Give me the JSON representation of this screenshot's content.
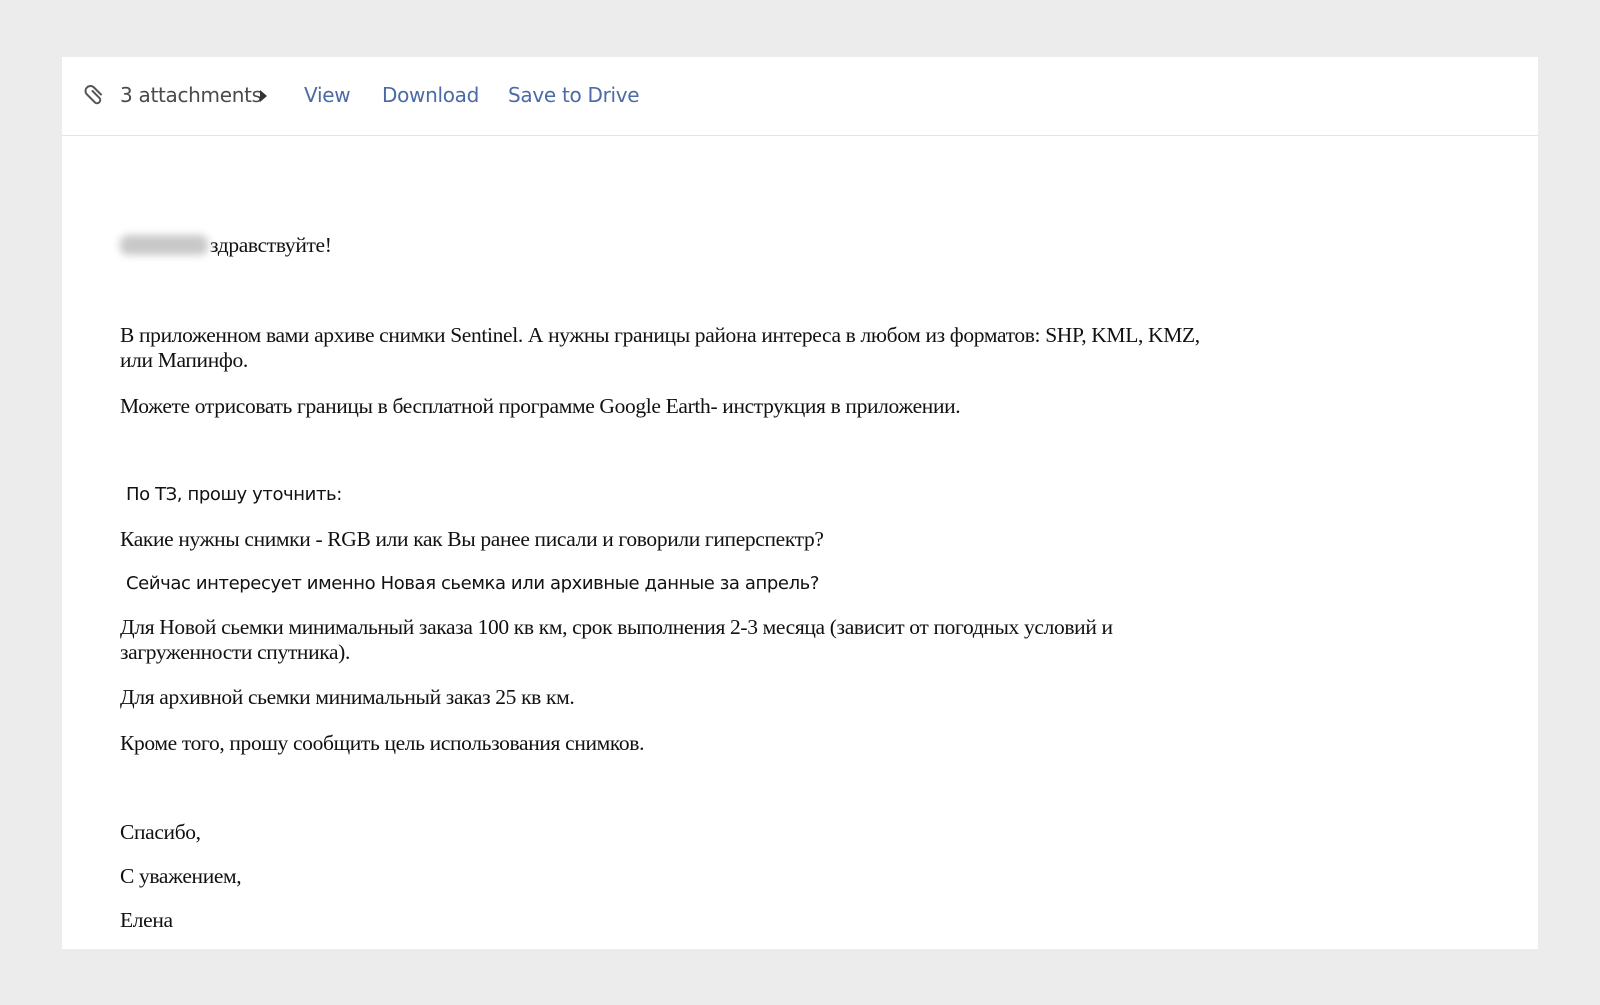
{
  "attachments": {
    "count_label": "3 attachments",
    "actions": [
      "View",
      "Download",
      "Save to Drive"
    ]
  },
  "message": {
    "greeting": "здравствуйте!",
    "p1": "В приложенном вами архиве снимки Sentinel. А нужны границы района интереса в  любом из форматов:  SHP, KML, KMZ, или Мапинфо.",
    "p2": "Можете  отрисовать границы в бесплатной программе Google Earth- инструкция в приложении.",
    "p3": "По ТЗ, прошу уточнить:",
    "p4": "Какие нужны снимки  -  RGB или как Вы ранее писали  и говорили гиперспектр?",
    "p5": "Сейчас интересует именно Новая сьемка или архивные данные за апрель?",
    "p6": "Для Новой сьемки минимальный заказа 100 кв км, срок выполнения 2-3 месяца (зависит от погодных условий и загруженности спутника).",
    "p7": "Для архивной сьемки минимальный заказ 25 кв км.",
    "p8": "Кроме того, прошу сообщить цель использования снимков.",
    "closing1": "Спасибо,",
    "closing2": "С уважением,",
    "signature": "Елена"
  },
  "colors": {
    "link": "#4a6aa8",
    "background": "#ececec",
    "card": "#ffffff"
  },
  "icons": [
    "paperclip-icon",
    "caret-right-icon"
  ]
}
